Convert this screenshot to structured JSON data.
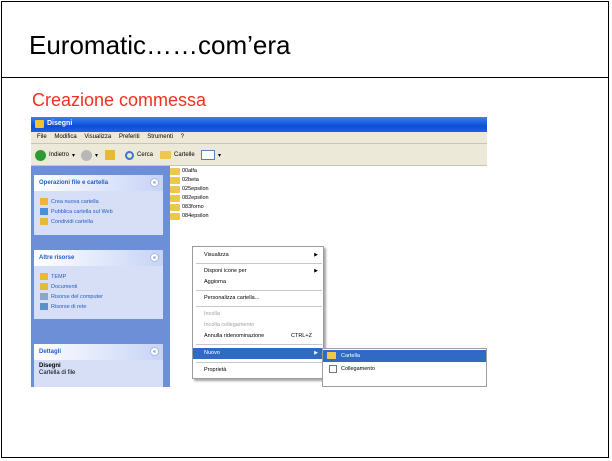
{
  "slide": {
    "title": "Euromatic……com’era",
    "subtitle": "Creazione commessa",
    "subtitle_color": "#f03020"
  },
  "window": {
    "title": "Disegni",
    "menu": [
      "File",
      "Modifica",
      "Visualizza",
      "Preferiti",
      "Strumenti",
      "?"
    ],
    "toolbar": {
      "back_label": "Indietro",
      "search_label": "Cerca",
      "folders_label": "Cartelle"
    }
  },
  "task_pane": {
    "file_tasks": {
      "title": "Operazioni file e cartella",
      "items": [
        "Crea nuova cartella",
        "Pubblica cartella sul Web",
        "Condividi cartella"
      ]
    },
    "other_places": {
      "title": "Altre risorse",
      "items": [
        "TEMP",
        "Documenti",
        "Risorse del computer",
        "Risorse di rete"
      ]
    },
    "details": {
      "title": "Dettagli",
      "name": "Disegni",
      "type": "Cartella di file"
    }
  },
  "files": [
    "00alfa",
    "02beta",
    "025epsilon",
    "082epsilon",
    "083forno",
    "084epsilon"
  ],
  "context_menu": {
    "items": [
      {
        "label": "Visualizza",
        "submenu": true
      },
      {
        "label": "Disponi icone per",
        "submenu": true
      },
      {
        "label": "Aggiorna"
      },
      {
        "label": "Personalizza cartella..."
      },
      {
        "label": "Incolla",
        "disabled": true
      },
      {
        "label": "Incolla collegamento",
        "disabled": true
      },
      {
        "label": "Annulla ridenominazione",
        "shortcut": "CTRL+Z"
      },
      {
        "label": "Nuovo",
        "submenu": true,
        "selected": true
      },
      {
        "label": "Proprietà"
      }
    ]
  },
  "submenu": {
    "items": [
      {
        "label": "Cartella",
        "selected": true
      },
      {
        "label": "Collegamento"
      }
    ]
  }
}
